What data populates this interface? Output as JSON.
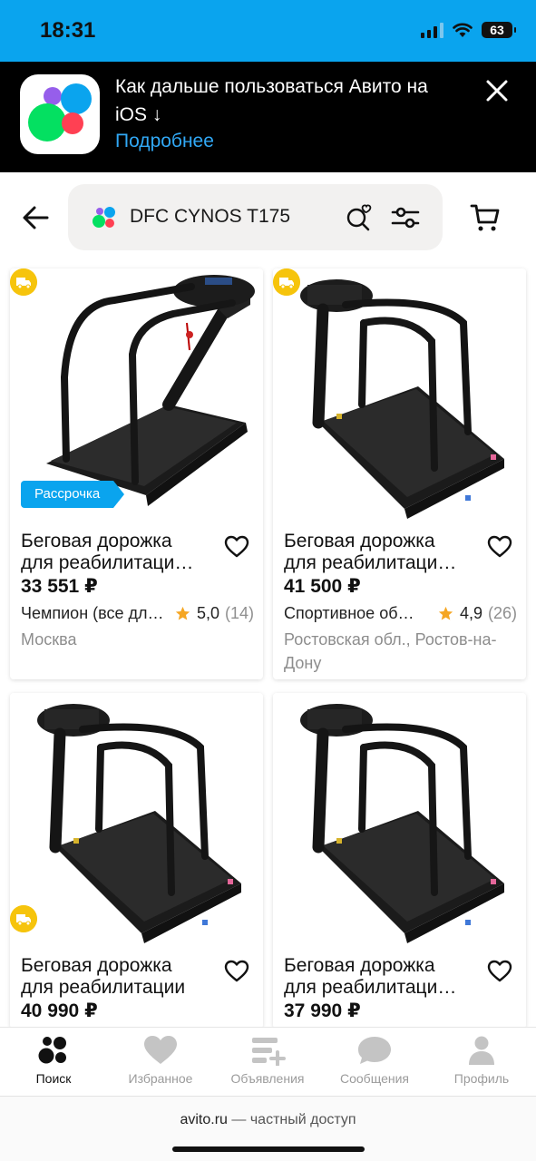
{
  "status_bar": {
    "time": "18:31",
    "battery": "63"
  },
  "banner": {
    "text": "Как дальше пользоваться Авито на iOS ↓",
    "link": "Подробнее",
    "close_icon": "close-icon"
  },
  "search": {
    "query": "DFC CYNOS T175",
    "icons": [
      "back-arrow-icon",
      "avito-dots-icon",
      "saved-search-heart-icon",
      "filter-sliders-icon",
      "cart-icon"
    ]
  },
  "listings": [
    {
      "title_line1": "Беговая дорожка",
      "title_line2": "для реабилитаци…",
      "price": "33 551 ₽",
      "seller": "Чемпион (все дл…",
      "rating": "5,0",
      "reviews": "(14)",
      "location": "Москва",
      "badge": "Рассрочка"
    },
    {
      "title_line1": "Беговая дорожка",
      "title_line2": "для реабилитаци…",
      "price": "41 500 ₽",
      "seller": "Спортивное об…",
      "rating": "4,9",
      "reviews": "(26)",
      "location": "Ростовская обл., Ростов-на-Дону"
    },
    {
      "title_line1": "Беговая дорожка",
      "title_line2": "для реабилитации",
      "price": "40 990 ₽"
    },
    {
      "title_line1": "Беговая дорожка",
      "title_line2": "для реабилитаци…",
      "price": "37 990 ₽"
    }
  ],
  "tabbar": {
    "items": [
      {
        "label": "Поиск",
        "icon": "search-dots-icon",
        "active": true
      },
      {
        "label": "Избранное",
        "icon": "heart-icon"
      },
      {
        "label": "Объявления",
        "icon": "add-listing-icon"
      },
      {
        "label": "Сообщения",
        "icon": "chat-bubble-icon"
      },
      {
        "label": "Профиль",
        "icon": "profile-icon"
      }
    ]
  },
  "browser": {
    "domain": "avito.ru",
    "suffix": " — частный доступ"
  },
  "colors": {
    "status_bar_bg": "#0aa4ee",
    "link": "#31a8f5",
    "badge": "#0aa4ee",
    "delivery": "#f6c40c",
    "star": "#f5a623"
  }
}
